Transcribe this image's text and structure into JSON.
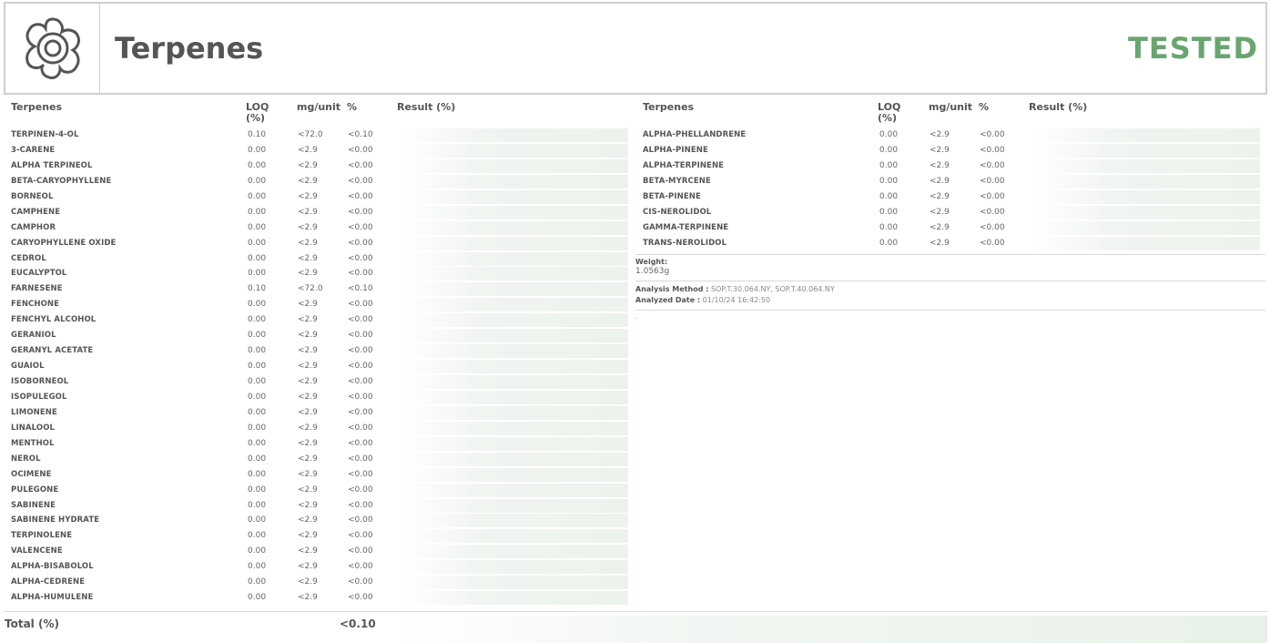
{
  "header": {
    "title": "Terpenes",
    "status": "TESTED",
    "status_color": "#6aa56f",
    "logo_icon": "terpene-flower-icon"
  },
  "columns": {
    "name": "Terpenes",
    "loq": "LOQ (%)",
    "mg": "mg/unit",
    "pct": "%",
    "result": "Result (%)"
  },
  "left_rows": [
    {
      "name": "TERPINEN-4-OL",
      "loq": "0.10",
      "mg": "<72.0",
      "pct": "<0.10"
    },
    {
      "name": "3-CARENE",
      "loq": "0.00",
      "mg": "<2.9",
      "pct": "<0.00"
    },
    {
      "name": "ALPHA TERPINEOL",
      "loq": "0.00",
      "mg": "<2.9",
      "pct": "<0.00"
    },
    {
      "name": "BETA-CARYOPHYLLENE",
      "loq": "0.00",
      "mg": "<2.9",
      "pct": "<0.00"
    },
    {
      "name": "BORNEOL",
      "loq": "0.00",
      "mg": "<2.9",
      "pct": "<0.00"
    },
    {
      "name": "CAMPHENE",
      "loq": "0.00",
      "mg": "<2.9",
      "pct": "<0.00"
    },
    {
      "name": "CAMPHOR",
      "loq": "0.00",
      "mg": "<2.9",
      "pct": "<0.00"
    },
    {
      "name": "CARYOPHYLLENE OXIDE",
      "loq": "0.00",
      "mg": "<2.9",
      "pct": "<0.00"
    },
    {
      "name": "CEDROL",
      "loq": "0.00",
      "mg": "<2.9",
      "pct": "<0.00"
    },
    {
      "name": "EUCALYPTOL",
      "loq": "0.00",
      "mg": "<2.9",
      "pct": "<0.00"
    },
    {
      "name": "FARNESENE",
      "loq": "0.10",
      "mg": "<72.0",
      "pct": "<0.10"
    },
    {
      "name": "FENCHONE",
      "loq": "0.00",
      "mg": "<2.9",
      "pct": "<0.00"
    },
    {
      "name": "FENCHYL ALCOHOL",
      "loq": "0.00",
      "mg": "<2.9",
      "pct": "<0.00"
    },
    {
      "name": "GERANIOL",
      "loq": "0.00",
      "mg": "<2.9",
      "pct": "<0.00"
    },
    {
      "name": "GERANYL ACETATE",
      "loq": "0.00",
      "mg": "<2.9",
      "pct": "<0.00"
    },
    {
      "name": "GUAIOL",
      "loq": "0.00",
      "mg": "<2.9",
      "pct": "<0.00"
    },
    {
      "name": "ISOBORNEOL",
      "loq": "0.00",
      "mg": "<2.9",
      "pct": "<0.00"
    },
    {
      "name": "ISOPULEGOL",
      "loq": "0.00",
      "mg": "<2.9",
      "pct": "<0.00"
    },
    {
      "name": "LIMONENE",
      "loq": "0.00",
      "mg": "<2.9",
      "pct": "<0.00"
    },
    {
      "name": "LINALOOL",
      "loq": "0.00",
      "mg": "<2.9",
      "pct": "<0.00"
    },
    {
      "name": "MENTHOL",
      "loq": "0.00",
      "mg": "<2.9",
      "pct": "<0.00"
    },
    {
      "name": "NEROL",
      "loq": "0.00",
      "mg": "<2.9",
      "pct": "<0.00"
    },
    {
      "name": "OCIMENE",
      "loq": "0.00",
      "mg": "<2.9",
      "pct": "<0.00"
    },
    {
      "name": "PULEGONE",
      "loq": "0.00",
      "mg": "<2.9",
      "pct": "<0.00"
    },
    {
      "name": "SABINENE",
      "loq": "0.00",
      "mg": "<2.9",
      "pct": "<0.00"
    },
    {
      "name": "SABINENE HYDRATE",
      "loq": "0.00",
      "mg": "<2.9",
      "pct": "<0.00"
    },
    {
      "name": "TERPINOLENE",
      "loq": "0.00",
      "mg": "<2.9",
      "pct": "<0.00"
    },
    {
      "name": "VALENCENE",
      "loq": "0.00",
      "mg": "<2.9",
      "pct": "<0.00"
    },
    {
      "name": "ALPHA-BISABOLOL",
      "loq": "0.00",
      "mg": "<2.9",
      "pct": "<0.00"
    },
    {
      "name": "ALPHA-CEDRENE",
      "loq": "0.00",
      "mg": "<2.9",
      "pct": "<0.00"
    },
    {
      "name": "ALPHA-HUMULENE",
      "loq": "0.00",
      "mg": "<2.9",
      "pct": "<0.00"
    }
  ],
  "right_rows": [
    {
      "name": "ALPHA-PHELLANDRENE",
      "loq": "0.00",
      "mg": "<2.9",
      "pct": "<0.00"
    },
    {
      "name": "ALPHA-PINENE",
      "loq": "0.00",
      "mg": "<2.9",
      "pct": "<0.00"
    },
    {
      "name": "ALPHA-TERPINENE",
      "loq": "0.00",
      "mg": "<2.9",
      "pct": "<0.00"
    },
    {
      "name": "BETA-MYRCENE",
      "loq": "0.00",
      "mg": "<2.9",
      "pct": "<0.00"
    },
    {
      "name": "BETA-PINENE",
      "loq": "0.00",
      "mg": "<2.9",
      "pct": "<0.00"
    },
    {
      "name": "CIS-NEROLIDOL",
      "loq": "0.00",
      "mg": "<2.9",
      "pct": "<0.00"
    },
    {
      "name": "GAMMA-TERPINENE",
      "loq": "0.00",
      "mg": "<2.9",
      "pct": "<0.00"
    },
    {
      "name": "TRANS-NEROLIDOL",
      "loq": "0.00",
      "mg": "<2.9",
      "pct": "<0.00"
    }
  ],
  "weight": {
    "label": "Weight:",
    "value": "1.0563g"
  },
  "analysis": {
    "method_label": "Analysis Method :",
    "method_value": "SOP.T.30.064.NY, SOP.T.40.064.NY",
    "date_label": "Analyzed Date :",
    "date_value": "01/10/24 16:42:50",
    "footnote": "-"
  },
  "total": {
    "label": "Total (%)",
    "value": "<0.10"
  }
}
